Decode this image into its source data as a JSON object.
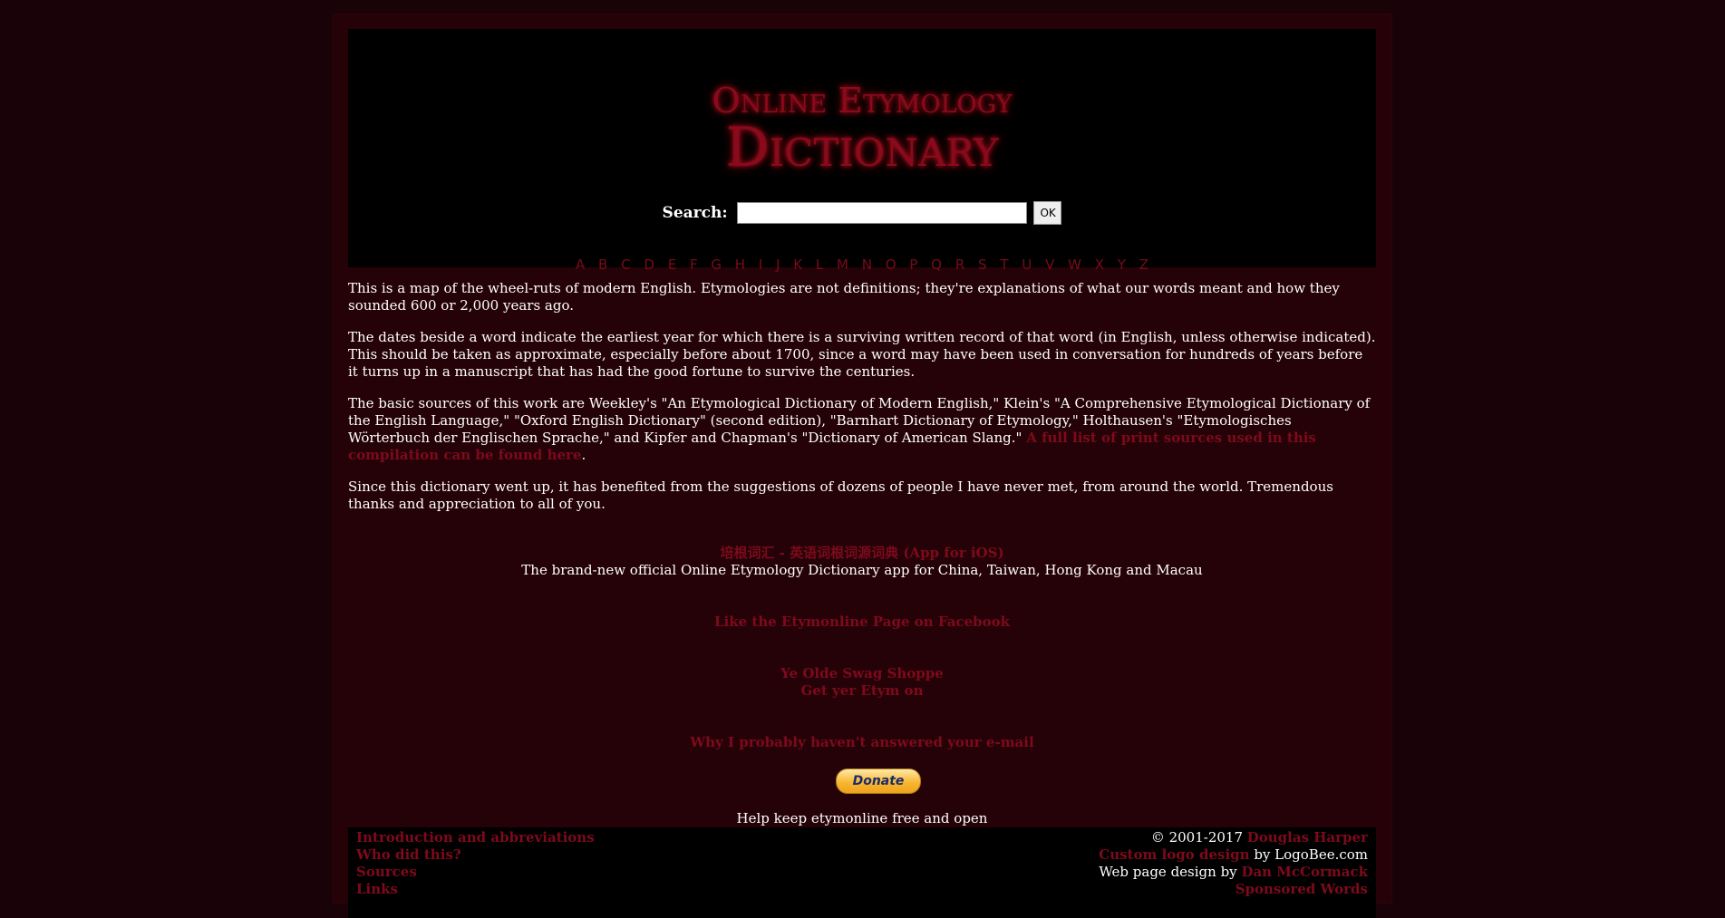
{
  "logo": {
    "line1": "Online Etymology",
    "line2": "Dictionary"
  },
  "search": {
    "label": "Search:",
    "value": "",
    "ok_label": "OK"
  },
  "alphabet": [
    "A",
    "B",
    "C",
    "D",
    "E",
    "F",
    "G",
    "H",
    "I",
    "J",
    "K",
    "L",
    "M",
    "N",
    "O",
    "P",
    "Q",
    "R",
    "S",
    "T",
    "U",
    "V",
    "W",
    "X",
    "Y",
    "Z"
  ],
  "intro": {
    "p1": "This is a map of the wheel-ruts of modern English. Etymologies are not definitions; they're explanations of what our words meant and how they sounded 600 or 2,000 years ago.",
    "p2": "The dates beside a word indicate the earliest year for which there is a surviving written record of that word (in English, unless otherwise indicated). This should be taken as approximate, especially before about 1700, since a word may have been used in conversation for hundreds of years before it turns up in a manuscript that has had the good fortune to survive the centuries.",
    "p3_text": "The basic sources of this work are Weekley's \"An Etymological Dictionary of Modern English,\" Klein's \"A Comprehensive Etymological Dictionary of the English Language,\" \"Oxford English Dictionary\" (second edition), \"Barnhart Dictionary of Etymology,\" Holthausen's \"Etymologisches Wörterbuch der Englischen Sprache,\" and Kipfer and Chapman's \"Dictionary of American Slang.\"",
    "p3_link": "A full list of print sources used in this compilation can be found here",
    "p3_end": ".",
    "p4": "Since this dictionary went up, it has benefited from the suggestions of dozens of people I have never met, from around the world. Tremendous thanks and appreciation to all of you."
  },
  "promo": {
    "app_link": "培根词汇 - 英语词根词源词典 (App for iOS)",
    "app_desc": "The brand-new official Online Etymology Dictionary app for China, Taiwan, Hong Kong and Macau",
    "facebook_link": "Like the Etymonline Page on Facebook",
    "swag_line1": "Ye Olde Swag Shoppe",
    "swag_line2": "Get yer Etym on",
    "email_link": "Why I probably haven't answered your e-mail",
    "donate_label": "Donate",
    "donate_caption": "Help keep etymonline free and open"
  },
  "footer": {
    "left_links": [
      "Introduction and abbreviations",
      "Who did this?",
      "Sources",
      "Links"
    ],
    "copyright_text": "© 2001-2017 ",
    "author_link": "Douglas Harper",
    "logo_link": "Custom logo design",
    "logo_by": " by LogoBee.com",
    "design_text": "Web page design by ",
    "designer_link": "Dan McCormack",
    "sponsored_link": "Sponsored Words"
  },
  "colors": {
    "background": "#1a0308",
    "panel": "#250208",
    "link": "#7e0a1c"
  }
}
